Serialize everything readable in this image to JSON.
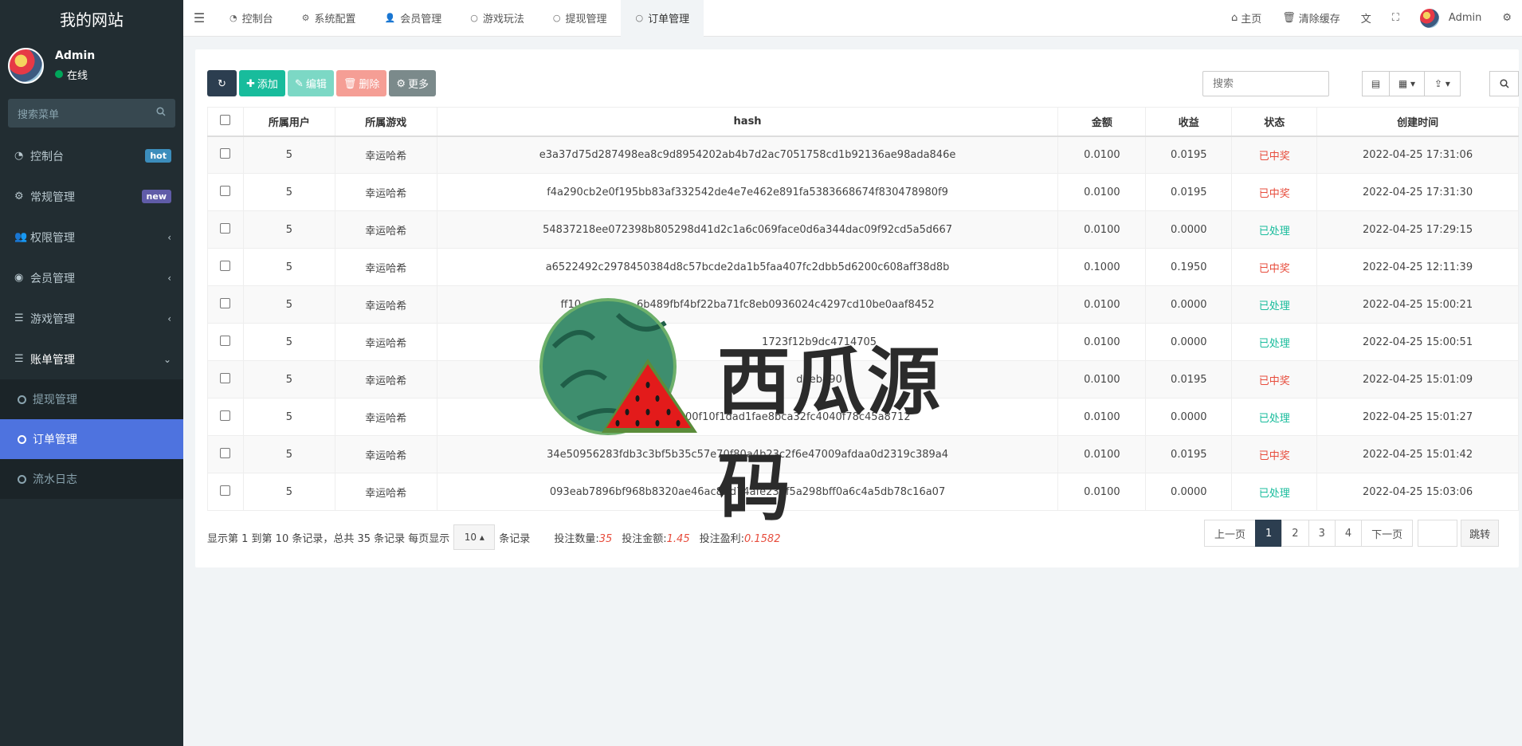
{
  "brand": "我的网站",
  "user": {
    "name": "Admin",
    "status": "在线"
  },
  "sidebar": {
    "search_placeholder": "搜索菜单",
    "items": [
      {
        "label": "控制台",
        "icon": "dashboard-icon",
        "badge": "hot"
      },
      {
        "label": "常规管理",
        "icon": "cogs-icon",
        "badge": "new"
      },
      {
        "label": "权限管理",
        "icon": "users-icon"
      },
      {
        "label": "会员管理",
        "icon": "user-circle-icon"
      },
      {
        "label": "游戏管理",
        "icon": "list-icon"
      },
      {
        "label": "账单管理",
        "icon": "list-icon"
      }
    ],
    "sub_items": [
      {
        "label": "提现管理"
      },
      {
        "label": "订单管理"
      },
      {
        "label": "流水日志"
      }
    ]
  },
  "topbar": {
    "tabs": [
      {
        "label": "控制台",
        "icon": "dashboard-icon"
      },
      {
        "label": "系统配置",
        "icon": "gear-icon"
      },
      {
        "label": "会员管理",
        "icon": "user-icon"
      },
      {
        "label": "游戏玩法",
        "icon": "circle-icon"
      },
      {
        "label": "提现管理",
        "icon": "circle-icon"
      },
      {
        "label": "订单管理",
        "icon": "circle-icon"
      }
    ],
    "right": {
      "home": "主页",
      "clear_cache": "清除缓存",
      "admin": "Admin"
    }
  },
  "toolbar": {
    "add": "添加",
    "edit": "编辑",
    "delete": "删除",
    "more": "更多",
    "search_placeholder": "搜索"
  },
  "table": {
    "headers": [
      "所属用户",
      "所属游戏",
      "hash",
      "金额",
      "收益",
      "状态",
      "创建时间"
    ],
    "rows": [
      {
        "user": "5",
        "game": "幸运哈希",
        "hash": "e3a37d75d287498ea8c9d8954202ab4b7d2ac7051758cd1b92136ae98ada846e",
        "amount": "0.0100",
        "profit": "0.0195",
        "status": "已中奖",
        "time": "2022-04-25 17:31:06"
      },
      {
        "user": "5",
        "game": "幸运哈希",
        "hash": "f4a290cb2e0f195bb83af332542de4e7e462e891fa5383668674f830478980f9",
        "amount": "0.0100",
        "profit": "0.0195",
        "status": "已中奖",
        "time": "2022-04-25 17:31:30"
      },
      {
        "user": "5",
        "game": "幸运哈希",
        "hash": "54837218ee072398b805298d41d2c1a6c069face0d6a344dac09f92cd5a5d667",
        "amount": "0.0100",
        "profit": "0.0000",
        "status": "已处理",
        "time": "2022-04-25 17:29:15"
      },
      {
        "user": "5",
        "game": "幸运哈希",
        "hash": "a6522492c2978450384d8c57bcde2da1b5faa407fc2dbb5d6200c608aff38d8b",
        "amount": "0.1000",
        "profit": "0.1950",
        "status": "已中奖",
        "time": "2022-04-25 12:11:39"
      },
      {
        "user": "5",
        "game": "幸运哈希",
        "hash": "ff10",
        "hash_tail": "6b489fbf4bf22ba71fc8eb0936024c4297cd10be0aaf8452",
        "amount": "0.0100",
        "profit": "0.0000",
        "status": "已处理",
        "time": "2022-04-25 15:00:21"
      },
      {
        "user": "5",
        "game": "幸运哈希",
        "hash": "",
        "hash_tail": "1723f12b9dc4714705",
        "amount": "0.0100",
        "profit": "0.0000",
        "status": "已处理",
        "time": "2022-04-25 15:00:51"
      },
      {
        "user": "5",
        "game": "幸运哈希",
        "hash": "",
        "hash_tail": "d2eb490",
        "amount": "0.0100",
        "profit": "0.0195",
        "status": "已中奖",
        "time": "2022-04-25 15:01:09"
      },
      {
        "user": "5",
        "game": "幸运哈希",
        "hash": "645",
        "hash_tail": "c75a00f10f1dad1fae8bca32fc4040f78c45a8712",
        "amount": "0.0100",
        "profit": "0.0000",
        "status": "已处理",
        "time": "2022-04-25 15:01:27"
      },
      {
        "user": "5",
        "game": "幸运哈希",
        "hash": "34e50956283fdb3c3bf5b35c57e70f80a4b23c2f6e47009afdaa0d2319c389a4",
        "amount": "0.0100",
        "profit": "0.0195",
        "status": "已中奖",
        "time": "2022-04-25 15:01:42"
      },
      {
        "user": "5",
        "game": "幸运哈希",
        "hash": "093eab7896bf968b8320ae46ac8ffd74afe236f5a298bff0a6c4a5db78c16a07",
        "amount": "0.0100",
        "profit": "0.0000",
        "status": "已处理",
        "time": "2022-04-25 15:03:06"
      }
    ]
  },
  "footer": {
    "summary_prefix": "显示第 1 到第 10 条记录，总共 35 条记录 每页显示",
    "page_size": "10",
    "summary_suffix": "条记录",
    "stats": [
      {
        "label": "投注数量:",
        "value": "35"
      },
      {
        "label": "投注金额:",
        "value": "1.45"
      },
      {
        "label": "投注盈利:",
        "value": "0.1582"
      }
    ]
  },
  "pagination": {
    "prev": "上一页",
    "pages": [
      "1",
      "2",
      "3",
      "4"
    ],
    "current": "1",
    "next": "下一页",
    "jump": "跳转"
  },
  "watermark": {
    "text": "西瓜源码"
  },
  "colors": {
    "sidebar_bg": "#222d32",
    "active_menu": "#4e73df",
    "success": "#18bc9c",
    "danger": "#e74c3c",
    "primary_dark": "#2c3e50"
  }
}
